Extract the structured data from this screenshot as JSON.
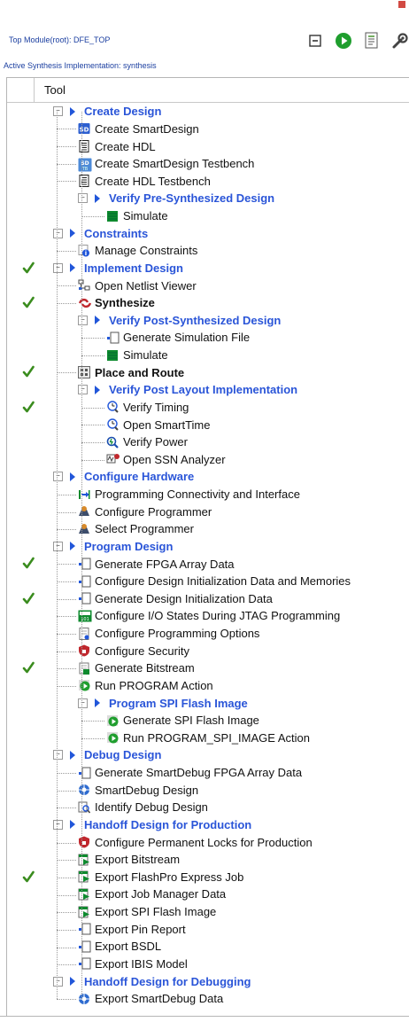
{
  "header": {
    "top_module": "Top Module(root): DFE_TOP",
    "active_impl": "Active Synthesis Implementation: synthesis"
  },
  "toolbar": [
    {
      "icon": "collapse-all-icon"
    },
    {
      "icon": "run-icon"
    },
    {
      "icon": "report-icon"
    },
    {
      "icon": "options-icon"
    }
  ],
  "column": {
    "label": "Tool"
  },
  "colors": {
    "group": "#2a55d8",
    "check": "#3a8c1e",
    "arrow": "#2156d9"
  },
  "rows": [
    {
      "label": "Create Design",
      "style": "group",
      "level": 0,
      "toggle": true,
      "check": false
    },
    {
      "label": "Create SmartDesign",
      "style": "normal",
      "level": 1,
      "icon": "sd-icon",
      "check": false
    },
    {
      "label": "Create HDL",
      "style": "normal",
      "level": 1,
      "icon": "hdl-file-icon",
      "check": false
    },
    {
      "label": "Create SmartDesign Testbench",
      "style": "normal",
      "level": 1,
      "icon": "sd-testbench-icon",
      "check": false
    },
    {
      "label": "Create HDL Testbench",
      "style": "normal",
      "level": 1,
      "icon": "hdl-file-icon",
      "check": false
    },
    {
      "label": "Verify Pre-Synthesized Design",
      "style": "group",
      "level": 1,
      "toggle": true,
      "check": false
    },
    {
      "label": "Simulate",
      "style": "normal",
      "level": 2,
      "icon": "simulate-icon",
      "check": false
    },
    {
      "label": "Constraints",
      "style": "group",
      "level": 0,
      "toggle": true,
      "check": false
    },
    {
      "label": "Manage Constraints",
      "style": "normal",
      "level": 1,
      "icon": "constraints-icon",
      "check": false
    },
    {
      "label": "Implement Design",
      "style": "group",
      "level": 0,
      "toggle": true,
      "check": true
    },
    {
      "label": "Open Netlist Viewer",
      "style": "normal",
      "level": 1,
      "icon": "netlist-icon",
      "check": false
    },
    {
      "label": "Synthesize",
      "style": "bold",
      "level": 1,
      "icon": "synthesize-icon",
      "check": true
    },
    {
      "label": "Verify Post-Synthesized Design",
      "style": "group",
      "level": 1,
      "toggle": true,
      "check": false
    },
    {
      "label": "Generate Simulation File",
      "style": "normal",
      "level": 2,
      "icon": "generate-file-icon",
      "check": false
    },
    {
      "label": "Simulate",
      "style": "normal",
      "level": 2,
      "icon": "simulate-icon",
      "check": false
    },
    {
      "label": "Place and Route",
      "style": "bold",
      "level": 1,
      "icon": "place-route-icon",
      "check": true
    },
    {
      "label": "Verify Post Layout Implementation",
      "style": "group",
      "level": 1,
      "toggle": true,
      "check": false
    },
    {
      "label": "Verify Timing",
      "style": "normal",
      "level": 2,
      "icon": "timing-icon",
      "check": true
    },
    {
      "label": "Open SmartTime",
      "style": "normal",
      "level": 2,
      "icon": "timing-icon",
      "check": false
    },
    {
      "label": "Verify Power",
      "style": "normal",
      "level": 2,
      "icon": "power-icon",
      "check": false
    },
    {
      "label": "Open SSN Analyzer",
      "style": "normal",
      "level": 2,
      "icon": "ssn-icon",
      "check": false
    },
    {
      "label": "Configure Hardware",
      "style": "group",
      "level": 0,
      "toggle": true,
      "check": false
    },
    {
      "label": "Programming Connectivity and Interface",
      "style": "normal",
      "level": 1,
      "icon": "connectivity-icon",
      "check": false
    },
    {
      "label": "Configure Programmer",
      "style": "normal",
      "level": 1,
      "icon": "programmer-icon",
      "check": false
    },
    {
      "label": "Select Programmer",
      "style": "normal",
      "level": 1,
      "icon": "programmer-icon",
      "check": false
    },
    {
      "label": "Program Design",
      "style": "group",
      "level": 0,
      "toggle": true,
      "check": false
    },
    {
      "label": "Generate FPGA Array Data",
      "style": "normal",
      "level": 1,
      "icon": "generate-file-icon",
      "check": true
    },
    {
      "label": "Configure Design Initialization Data and Memories",
      "style": "normal",
      "level": 1,
      "icon": "generate-file-icon",
      "check": false
    },
    {
      "label": "Generate Design Initialization Data",
      "style": "normal",
      "level": 1,
      "icon": "generate-file-icon",
      "check": true
    },
    {
      "label": "Configure I/O States During JTAG Programming",
      "style": "normal",
      "level": 1,
      "icon": "io-states-icon",
      "check": false
    },
    {
      "label": "Configure Programming Options",
      "style": "normal",
      "level": 1,
      "icon": "options-file-icon",
      "check": false
    },
    {
      "label": "Configure Security",
      "style": "normal",
      "level": 1,
      "icon": "security-icon",
      "check": false
    },
    {
      "label": "Generate Bitstream",
      "style": "normal",
      "level": 1,
      "icon": "bitstream-icon",
      "check": true
    },
    {
      "label": "Run PROGRAM Action",
      "style": "normal",
      "level": 1,
      "icon": "run-action-icon",
      "check": false
    },
    {
      "label": "Program SPI Flash Image",
      "style": "group",
      "level": 1,
      "toggle": true,
      "check": false
    },
    {
      "label": "Generate SPI Flash Image",
      "style": "normal",
      "level": 2,
      "icon": "run-action-icon",
      "check": false
    },
    {
      "label": "Run PROGRAM_SPI_IMAGE Action",
      "style": "normal",
      "level": 2,
      "icon": "run-action-icon",
      "check": false
    },
    {
      "label": "Debug Design",
      "style": "group",
      "level": 0,
      "toggle": true,
      "check": false
    },
    {
      "label": "Generate SmartDebug FPGA Array Data",
      "style": "normal",
      "level": 1,
      "icon": "generate-file-icon",
      "check": false
    },
    {
      "label": "SmartDebug Design",
      "style": "normal",
      "level": 1,
      "icon": "smartdebug-icon",
      "check": false
    },
    {
      "label": "Identify Debug Design",
      "style": "normal",
      "level": 1,
      "icon": "identify-icon",
      "check": false
    },
    {
      "label": "Handoff Design for Production",
      "style": "group",
      "level": 0,
      "toggle": true,
      "check": false
    },
    {
      "label": "Configure Permanent Locks for Production",
      "style": "normal",
      "level": 1,
      "icon": "security-icon",
      "check": false
    },
    {
      "label": "Export Bitstream",
      "style": "normal",
      "level": 1,
      "icon": "export-icon",
      "check": false
    },
    {
      "label": "Export FlashPro Express Job",
      "style": "normal",
      "level": 1,
      "icon": "export-icon",
      "check": true
    },
    {
      "label": "Export Job Manager Data",
      "style": "normal",
      "level": 1,
      "icon": "export-icon",
      "check": false
    },
    {
      "label": "Export SPI Flash Image",
      "style": "normal",
      "level": 1,
      "icon": "export-icon",
      "check": false
    },
    {
      "label": "Export Pin Report",
      "style": "normal",
      "level": 1,
      "icon": "generate-file-icon",
      "check": false
    },
    {
      "label": "Export BSDL",
      "style": "normal",
      "level": 1,
      "icon": "generate-file-icon",
      "check": false
    },
    {
      "label": "Export IBIS Model",
      "style": "normal",
      "level": 1,
      "icon": "generate-file-icon",
      "check": false
    },
    {
      "label": "Handoff Design for Debugging",
      "style": "group",
      "level": 0,
      "toggle": true,
      "check": false
    },
    {
      "label": "Export SmartDebug Data",
      "style": "normal",
      "level": 1,
      "icon": "smartdebug-icon",
      "check": false
    }
  ]
}
